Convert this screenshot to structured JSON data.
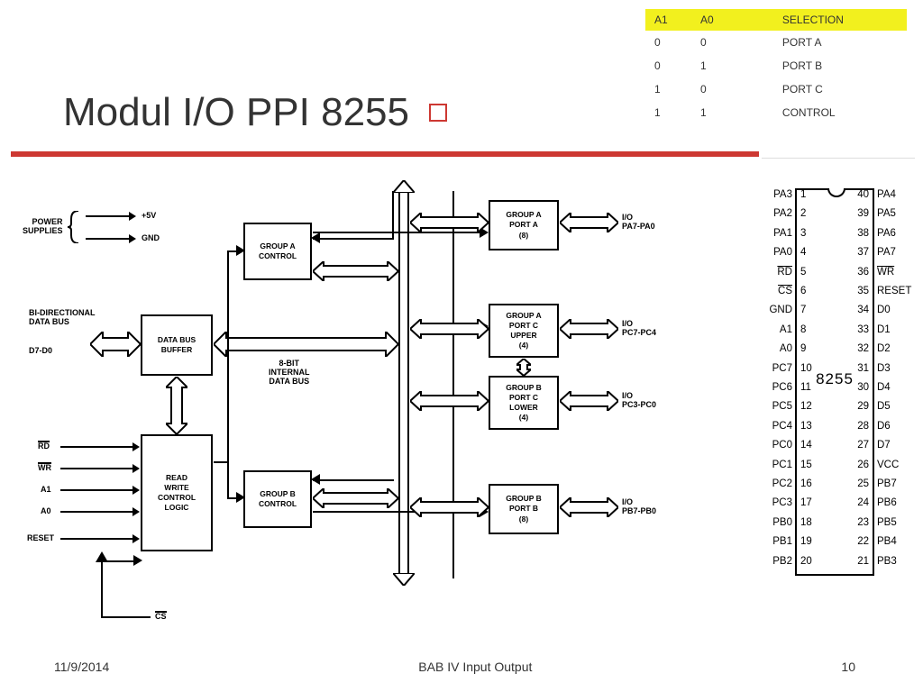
{
  "title": "Modul I/O PPI 8255",
  "footer": {
    "date": "11/9/2014",
    "center": "BAB IV  Input Output",
    "page": "10"
  },
  "table": {
    "headers": [
      "A1",
      "A0",
      "SELECTION"
    ],
    "rows": [
      [
        "0",
        "0",
        "PORT A"
      ],
      [
        "0",
        "1",
        "PORT B"
      ],
      [
        "1",
        "0",
        "PORT C"
      ],
      [
        "1",
        "1",
        "CONTROL"
      ]
    ]
  },
  "diagram": {
    "power": "POWER\nSUPPLIES",
    "v5": "+5V",
    "gnd": "GND",
    "bidir": "BI-DIRECTIONAL\nDATA BUS",
    "d7d0": "D7-D0",
    "dbb": "DATA BUS\nBUFFER",
    "rwcl": "READ\nWRITE\nCONTROL\nLOGIC",
    "rd": "RD",
    "wr": "WR",
    "a1": "A1",
    "a0": "A0",
    "reset": "RESET",
    "cs": "CS",
    "gac": "GROUP A\nCONTROL",
    "gbc": "GROUP B\nCONTROL",
    "gapa": "GROUP A\nPORT A\n(8)",
    "gapcu": "GROUP A\nPORT C\nUPPER\n(4)",
    "gbpcl": "GROUP B\nPORT C\nLOWER\n(4)",
    "gbpb": "GROUP B\nPORT B\n(8)",
    "bus8": "8-BIT\nINTERNAL\nDATA BUS",
    "io_pa": "I/O\nPA7-PA0",
    "io_pc74": "I/O\nPC7-PC4",
    "io_pc30": "I/O\nPC3-PC0",
    "io_pb": "I/O\nPB7-PB0"
  },
  "chip": {
    "name": "8255",
    "left": [
      "PA3",
      "PA2",
      "PA1",
      "PA0",
      "RD",
      "CS",
      "GND",
      "A1",
      "A0",
      "PC7",
      "PC6",
      "PC5",
      "PC4",
      "PC0",
      "PC1",
      "PC2",
      "PC3",
      "PB0",
      "PB1",
      "PB2"
    ],
    "right": [
      "PA4",
      "PA5",
      "PA6",
      "PA7",
      "WR",
      "RESET",
      "D0",
      "D1",
      "D2",
      "D3",
      "D4",
      "D5",
      "D6",
      "D7",
      "VCC",
      "PB7",
      "PB6",
      "PB5",
      "PB4",
      "PB3"
    ],
    "lnum": [
      "1",
      "2",
      "3",
      "4",
      "5",
      "6",
      "7",
      "8",
      "9",
      "10",
      "11",
      "12",
      "13",
      "14",
      "15",
      "16",
      "17",
      "18",
      "19",
      "20"
    ],
    "rnum": [
      "40",
      "39",
      "38",
      "37",
      "36",
      "35",
      "34",
      "33",
      "32",
      "31",
      "30",
      "29",
      "28",
      "27",
      "26",
      "25",
      "24",
      "23",
      "22",
      "21"
    ],
    "ov_left": [
      4,
      5
    ],
    "ov_right": [
      4
    ]
  }
}
